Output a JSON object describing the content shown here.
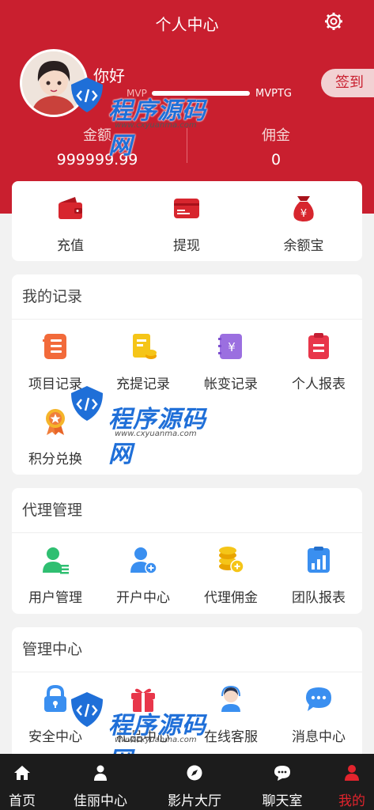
{
  "header": {
    "title": "个人中心",
    "greeting": "你好",
    "mvp_left": "MVP",
    "mvp_right": "MVPTG",
    "signin_label": "签到",
    "balance_label": "金额",
    "balance_value": "999999.99",
    "commission_label": "佣金",
    "commission_value": "0"
  },
  "wallet": {
    "items": [
      {
        "label": "充值",
        "icon": "wallet-icon"
      },
      {
        "label": "提现",
        "icon": "card-icon"
      },
      {
        "label": "余额宝",
        "icon": "money-bag-icon"
      }
    ]
  },
  "records": {
    "title": "我的记录",
    "items": [
      {
        "label": "项目记录",
        "icon": "list-icon"
      },
      {
        "label": "充提记录",
        "icon": "receipt-icon"
      },
      {
        "label": "帐变记录",
        "icon": "ledger-icon"
      },
      {
        "label": "个人报表",
        "icon": "clipboard-icon"
      },
      {
        "label": "积分兑换",
        "icon": "medal-icon"
      }
    ]
  },
  "agent": {
    "title": "代理管理",
    "items": [
      {
        "label": "用户管理",
        "icon": "user-manage-icon"
      },
      {
        "label": "开户中心",
        "icon": "add-user-icon"
      },
      {
        "label": "代理佣金",
        "icon": "coins-icon"
      },
      {
        "label": "团队报表",
        "icon": "chart-report-icon"
      }
    ]
  },
  "manage": {
    "title": "管理中心",
    "items": [
      {
        "label": "安全中心",
        "icon": "lock-icon"
      },
      {
        "label": "礼品中心",
        "icon": "gift-icon"
      },
      {
        "label": "在线客服",
        "icon": "headset-icon"
      },
      {
        "label": "消息中心",
        "icon": "chat-bubble-icon"
      }
    ]
  },
  "watermark": {
    "text": "程序源码网",
    "url": "www.cxyuanma.com"
  },
  "nav": {
    "tabs": [
      {
        "label": "首页",
        "icon": "home-icon"
      },
      {
        "label": "佳丽中心",
        "icon": "person-icon"
      },
      {
        "label": "影片大厅",
        "icon": "compass-icon"
      },
      {
        "label": "聊天室",
        "icon": "chat-icon"
      },
      {
        "label": "我的",
        "icon": "user-icon"
      }
    ],
    "active_index": 4
  },
  "colors": {
    "brand_red": "#c91f2f",
    "nav_bg": "#1c1c1c",
    "active_tab": "#e2242d"
  }
}
